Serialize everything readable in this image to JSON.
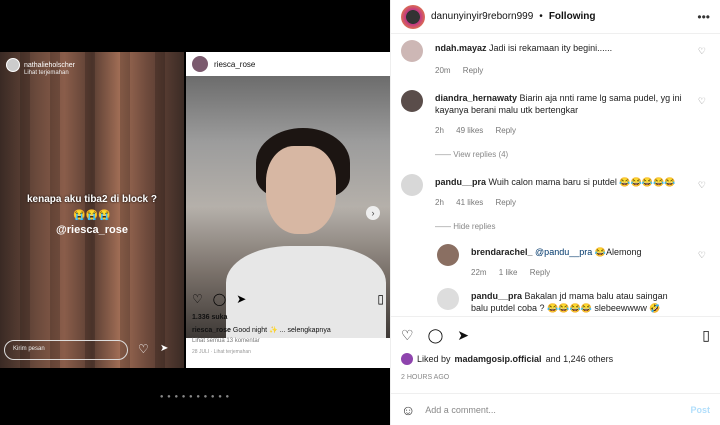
{
  "story": {
    "username": "nathalieholscher",
    "subtitle": "Lihat terjemahan",
    "text": "kenapa aku tiba2 di block ?",
    "emoji": "😭😭😭",
    "mention": "@riesca_rose",
    "input_placeholder": "Kirim pesan"
  },
  "post": {
    "username": "riesca_rose",
    "likes": "1.336 suka",
    "caption_user": "riesca_rose",
    "caption_text": "Good night ✨ ... selengkapnya",
    "comments_link": "Lihat semua 13 komentar",
    "date": "28 JULI · Lihat terjemahan"
  },
  "header": {
    "username": "danunyinyir9reborn999",
    "separator": "•",
    "following": "Following"
  },
  "comments": [
    {
      "user": "ndah.mayaz",
      "text": "Jadi isi rekamaan ity begini......",
      "time": "20m",
      "likes": "",
      "reply": "Reply"
    },
    {
      "user": "diandra_hernawaty",
      "text": "Biarin aja nnti rame lg sama pudel, yg ini kayanya berani malu utk bertengkar",
      "time": "2h",
      "likes": "49 likes",
      "reply": "Reply"
    },
    {
      "user": "pandu__pra",
      "text": "Wuih calon mama baru si putdel 😂😂😂😂😂",
      "time": "2h",
      "likes": "41 likes",
      "reply": "Reply"
    },
    {
      "user": "brendarachel_",
      "mention": "@pandu__pra",
      "text": "😂Alemong",
      "time": "22m",
      "likes": "1 like",
      "reply": "Reply"
    },
    {
      "user": "pandu__pra",
      "text": "Bakalan jd mama balu atau saingan balu putdel coba ? 😂😂😂😂 slebeewwww 🤣",
      "time": "",
      "likes": "",
      "reply": ""
    }
  ],
  "threads": {
    "view_replies": "View replies (4)",
    "hide_replies": "Hide replies"
  },
  "footer": {
    "liked_prefix": "Liked by",
    "liked_user": "madamgosip.official",
    "liked_suffix": "and 1,246 others",
    "time": "2 HOURS AGO",
    "add_placeholder": "Add a comment...",
    "post_label": "Post"
  }
}
